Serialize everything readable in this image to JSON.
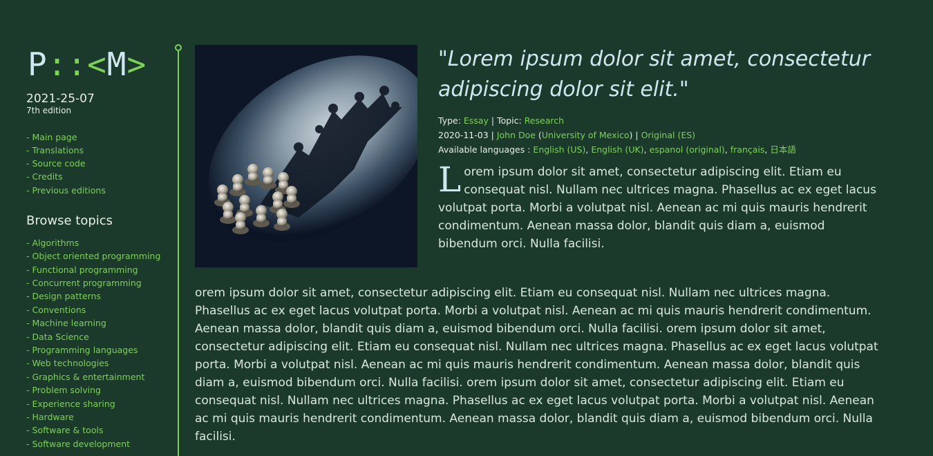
{
  "logo": {
    "p": "P",
    "colons": "::",
    "lt": "<",
    "m": "M",
    "gt": ">"
  },
  "sidebar": {
    "date": "2021-25-07",
    "edition": "7th edition",
    "nav": [
      "- Main page",
      "- Translations",
      "- Source code",
      "- Credits",
      "- Previous editions"
    ],
    "browse_title": "Browse topics",
    "topics": [
      "- Algorithms",
      "- Object oriented programming",
      "- Functional programming",
      "- Concurrent programming",
      "- Design patterns",
      "- Conventions",
      "- Machine learning",
      "- Data Science",
      "- Programming languages",
      "- Web technologies",
      "- Graphics & entertainment",
      "- Problem solving",
      "- Experience sharing",
      "- Hardware",
      "- Software & tools",
      "- Software development"
    ]
  },
  "article": {
    "quote": "\"Lorem ipsum dolor sit amet, consectetur adipiscing dolor sit elit.\"",
    "meta": {
      "type_label": "Type: ",
      "type_value": "Essay",
      "sep": " | ",
      "topic_label": "Topic: ",
      "topic_value": "Research",
      "date": "2020-11-03",
      "author": "John Doe",
      "open_paren": " (",
      "affiliation": "University of Mexico",
      "close_paren": ")",
      "original": "Original (ES)",
      "languages_label": "Available languages : ",
      "languages": [
        "English (US)",
        "English (UK)",
        "espanol (original)",
        "français",
        "日本語"
      ]
    },
    "dropcap": "L",
    "lead": "orem ipsum dolor sit amet, consectetur adipiscing elit. Etiam eu consequat nisl. Nullam nec ultrices magna. Phasellus ac ex eget lacus volutpat porta. Morbi a volutpat nisl. Aenean ac mi quis mauris hendrerit condimentum. Aenean massa dolor, blandit quis diam a, euismod bibendum orci. Nulla facilisi.",
    "body": " orem ipsum dolor sit amet, consectetur adipiscing elit. Etiam eu consequat nisl. Nullam nec ultrices magna. Phasellus ac ex eget lacus volutpat porta. Morbi a volutpat nisl. Aenean ac mi quis mauris hendrerit condimentum. Aenean massa dolor, blandit quis diam a, euismod bibendum orci. Nulla facilisi.  orem ipsum dolor sit amet, consectetur adipiscing elit. Etiam eu consequat nisl. Nullam nec ultrices magna. Phasellus ac ex eget lacus volutpat porta. Morbi a volutpat nisl. Aenean ac mi quis mauris hendrerit condimentum. Aenean massa dolor, blandit quis diam a, euismod bibendum orci. Nulla facilisi.  orem ipsum dolor sit amet, consectetur adipiscing elit. Etiam eu consequat nisl. Nullam nec ultrices magna. Phasellus ac ex eget lacus volutpat porta. Morbi a volutpat nisl. Aenean ac mi quis mauris hendrerit condimentum. Aenean massa dolor, blandit quis diam a, euismod bibendum orci. Nulla facilisi."
  },
  "colors": {
    "background": "#1b3a2b",
    "accent": "#7ed15a",
    "heading": "#cfe8f0"
  }
}
